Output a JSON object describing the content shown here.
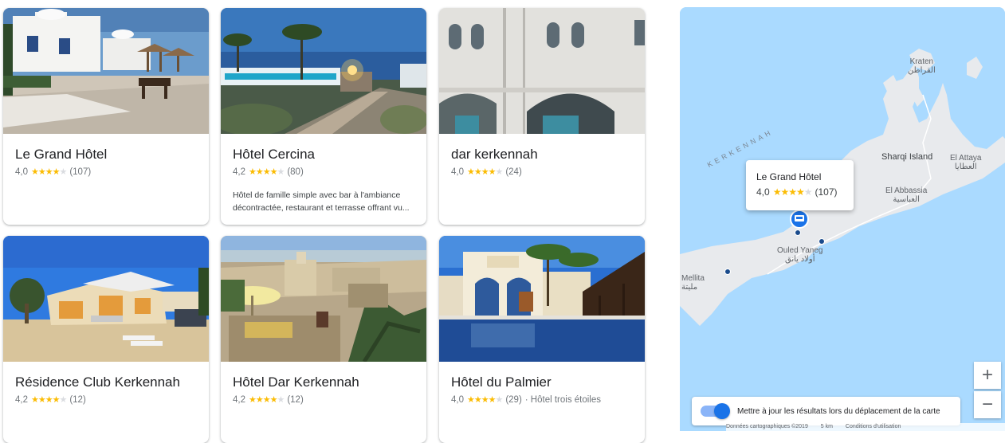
{
  "hotels": [
    {
      "name": "Le Grand Hôtel",
      "rating": "4,0",
      "stars": 4,
      "reviews": "(107)",
      "description": "",
      "extra": ""
    },
    {
      "name": "Hôtel Cercina",
      "rating": "4,2",
      "stars": 4,
      "reviews": "(80)",
      "description": "Hôtel de famille simple avec bar à l'ambiance décontractée, restaurant et terrasse offrant vu...",
      "extra": ""
    },
    {
      "name": "dar kerkennah",
      "rating": "4,0",
      "stars": 4,
      "reviews": "(24)",
      "description": "",
      "extra": ""
    },
    {
      "name": "Résidence Club Kerkennah",
      "rating": "4,2",
      "stars": 4,
      "reviews": "(12)",
      "description": "",
      "extra": ""
    },
    {
      "name": "Hôtel Dar Kerkennah",
      "rating": "4,2",
      "stars": 4,
      "reviews": "(12)",
      "description": "",
      "extra": ""
    },
    {
      "name": "Hôtel du Palmier",
      "rating": "4,0",
      "stars": 4,
      "reviews": "(29)",
      "description": "",
      "extra": "· Hôtel trois étoiles"
    }
  ],
  "map": {
    "region_label": "KERKENNAH",
    "places": {
      "kraten": "Kraten",
      "kraten_ar": "القراطن",
      "sharqi": "Sharqi Island",
      "el_attaya": "El Attaya",
      "el_attaya_ar": "العطايا",
      "el_abbassia": "El Abbassia",
      "el_abbassia_ar": "العباسية",
      "ouled_yaneg": "Ouled Yaneg",
      "ouled_yaneg_ar": "أولاد يانق",
      "mellita": "Mellita",
      "mellita_ar": "مليتة"
    },
    "popup": {
      "name": "Le Grand Hôtel",
      "rating": "4,0",
      "stars": 4,
      "reviews": "(107)"
    },
    "update_toggle_label": "Mettre à jour les résultats lors du déplacement de la carte",
    "update_toggle_on": true,
    "zoom_in": "+",
    "zoom_out": "−",
    "attribution": {
      "data": "Données cartographiques ©2019",
      "scale": "5 km",
      "terms": "Conditions d'utilisation"
    },
    "colors": {
      "water": "#aadaff",
      "land": "#e8eaed",
      "accent": "#1a73e8",
      "stars": "#fbbc04"
    }
  }
}
